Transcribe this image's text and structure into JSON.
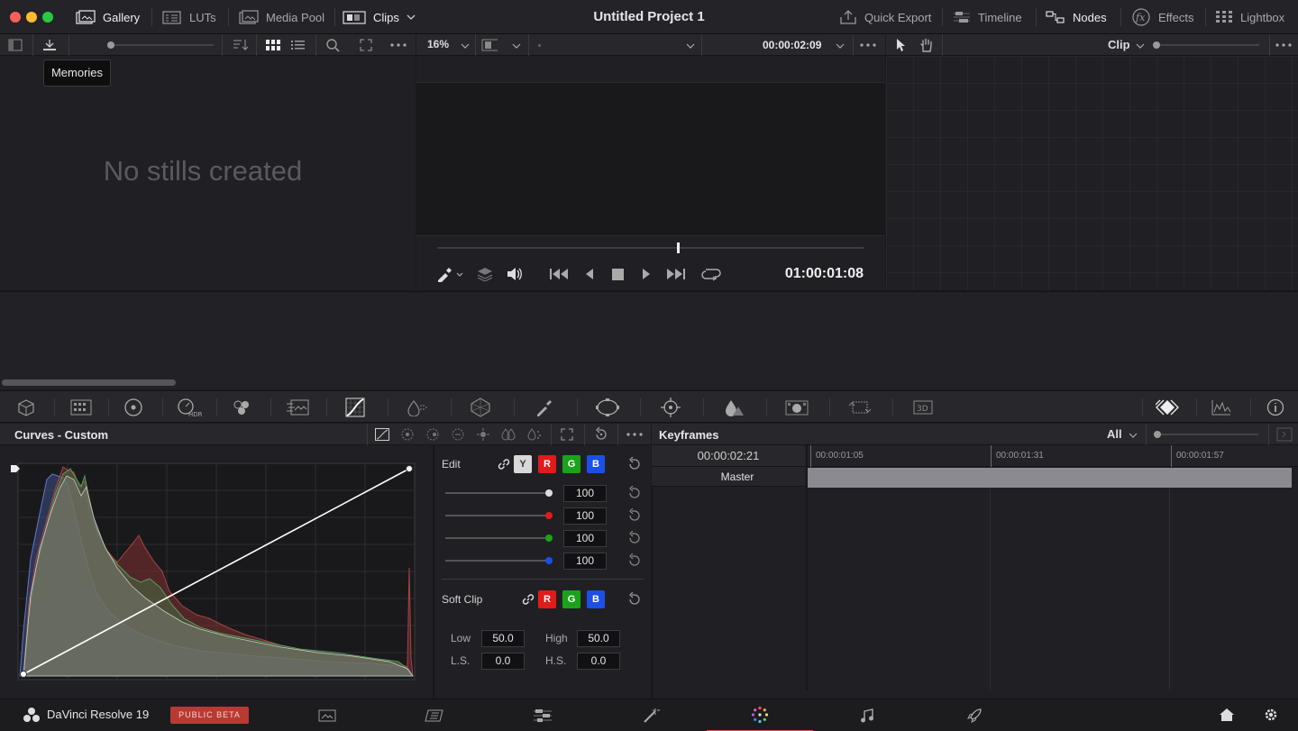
{
  "topbar": {
    "gallery": "Gallery",
    "luts": "LUTs",
    "media_pool": "Media Pool",
    "clips": "Clips",
    "project_title": "Untitled Project 1",
    "quick_export": "Quick Export",
    "timeline": "Timeline",
    "nodes": "Nodes",
    "effects": "Effects",
    "lightbox": "Lightbox"
  },
  "gallery": {
    "tooltip": "Memories",
    "empty_text": "No stills created"
  },
  "viewer": {
    "zoom": "16%",
    "source_timecode": "00:00:02:09",
    "playhead_timecode": "01:00:01:08"
  },
  "nodes": {
    "mode": "Clip"
  },
  "curves": {
    "title": "Curves - Custom"
  },
  "edit": {
    "label": "Edit",
    "channels": [
      "Y",
      "R",
      "G",
      "B"
    ],
    "values": [
      "100",
      "100",
      "100",
      "100"
    ],
    "soft_clip_label": "Soft Clip",
    "soft_channels": [
      "R",
      "G",
      "B"
    ],
    "low_label": "Low",
    "low_value": "50.0",
    "high_label": "High",
    "high_value": "50.0",
    "ls_label": "L.S.",
    "ls_value": "0.0",
    "hs_label": "H.S.",
    "hs_value": "0.0"
  },
  "keyframes": {
    "title": "Keyframes",
    "filter": "All",
    "current_timecode": "00:00:02:21",
    "ruler": [
      "00:00:01:05",
      "00:00:01:31",
      "00:00:01:57"
    ],
    "track": "Master"
  },
  "bottombar": {
    "app_name": "DaVinci Resolve 19",
    "badge": "PUBLIC BETA"
  },
  "colors": {
    "accent_red": "#e2564a",
    "chan_red": "#e11b1b",
    "chan_green": "#1aa31a",
    "chan_blue": "#1b4fe8"
  }
}
